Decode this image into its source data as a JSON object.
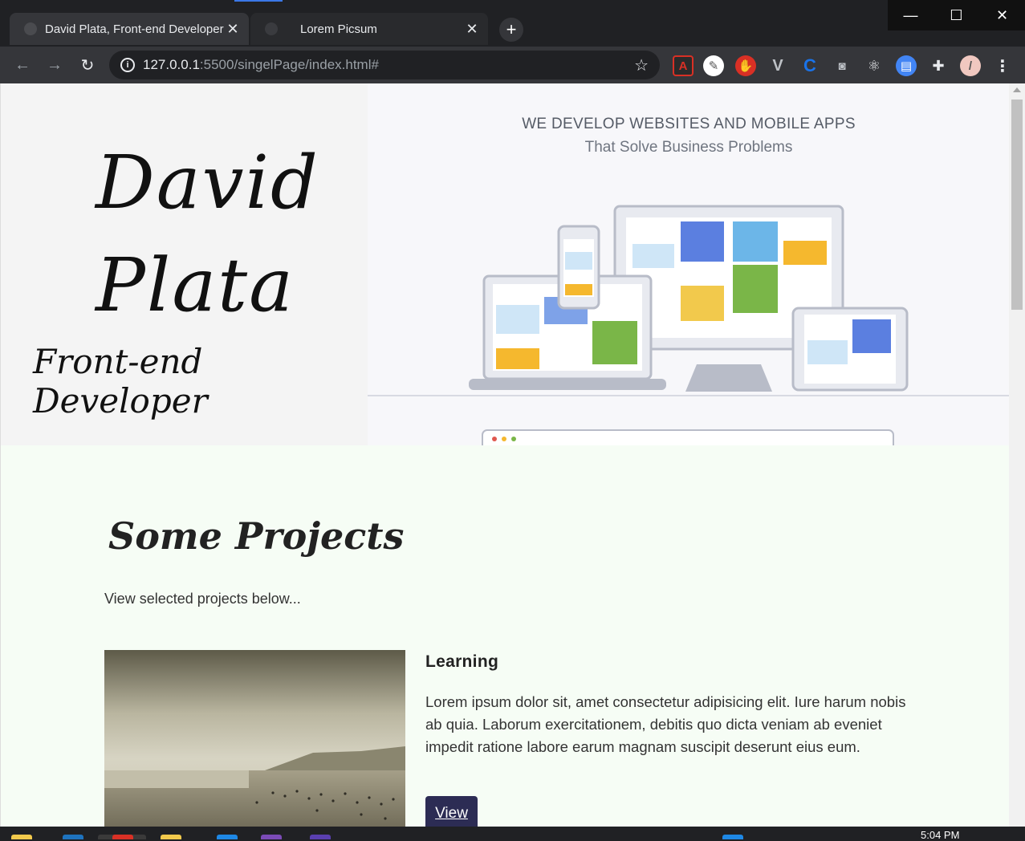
{
  "browser": {
    "tabs": [
      {
        "title": "David Plata, Front-end Developer",
        "active": true
      },
      {
        "title": "Lorem Picsum",
        "active": false
      }
    ],
    "new_tab_symbol": "+",
    "url_host": "127.0.0.1",
    "url_path": ":5500/singelPage/index.html#",
    "window_controls": [
      "minimize-icon",
      "maximize-icon",
      "close-icon"
    ],
    "extensions": [
      "pdf-icon",
      "chat-icon",
      "ublock-icon",
      "vimium-icon",
      "cortex-icon",
      "camera-icon",
      "react-devtools-icon",
      "docs-icon",
      "puzzle-icon",
      "profile-avatar",
      "kebab-menu-icon"
    ]
  },
  "hero": {
    "name_first": "David",
    "name_last": "Plata",
    "role": "Front-end Developer",
    "tagline": "WE DEVELOP WEBSITES AND MOBILE APPS",
    "subtagline": "That Solve Business Problems"
  },
  "projects": {
    "title": "Some Projects",
    "subtitle": "View selected projects below...",
    "items": [
      {
        "title": "Learning",
        "description": "Lorem ipsum dolor sit, amet consectetur adipisicing elit. Iure harum nobis ab quia. Laborum exercitationem, debitis quo dicta veniam ab eveniet impedit ratione labore earum magnam suscipit deserunt eius eum.",
        "button_label": "View"
      }
    ]
  },
  "taskbar": {
    "clock": "5:04 PM"
  },
  "colors": {
    "chrome_dark": "#202124",
    "toolbar": "#35363a",
    "projects_bg": "#f6fdf5",
    "button": "#2c2c54"
  }
}
